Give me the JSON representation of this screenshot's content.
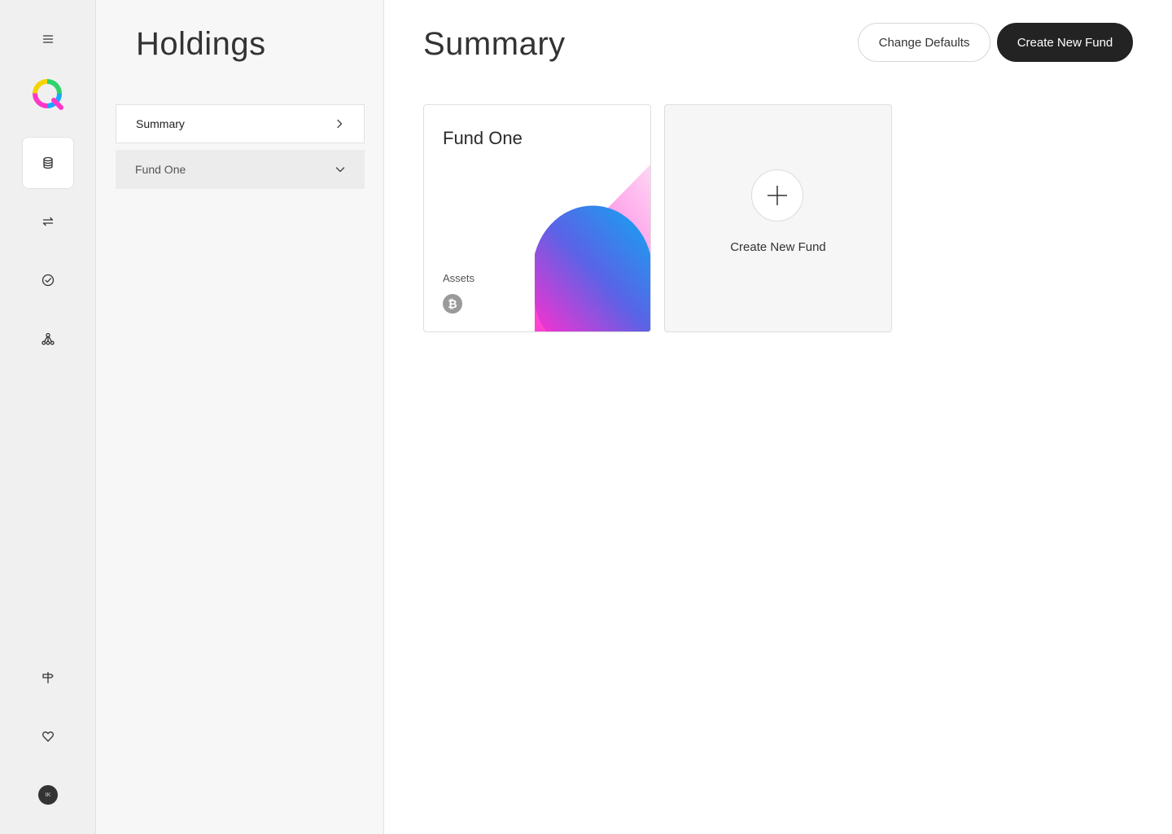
{
  "sidebar": {
    "avatar_initials": "IK",
    "icons": [
      "menu-icon",
      "logo-icon",
      "database-icon",
      "transfer-icon",
      "check-circle-icon",
      "network-icon",
      "signpost-icon",
      "heart-icon"
    ]
  },
  "panel": {
    "title": "Holdings",
    "items": [
      {
        "label": "Summary",
        "icon": "chevron-right-icon"
      },
      {
        "label": "Fund One",
        "icon": "chevron-down-icon"
      }
    ]
  },
  "main": {
    "title": "Summary",
    "change_defaults_label": "Change Defaults",
    "create_fund_label": "Create New Fund"
  },
  "cards": {
    "fund": {
      "title": "Fund One",
      "assets_label": "Assets",
      "asset_icon": "bitcoin-icon"
    },
    "new_fund": {
      "label": "Create New Fund",
      "icon": "plus-icon"
    }
  },
  "colors": {
    "primary_button": "#232323",
    "gradient_pink": "#ff3fd0",
    "gradient_blue": "#1a9ff0"
  }
}
